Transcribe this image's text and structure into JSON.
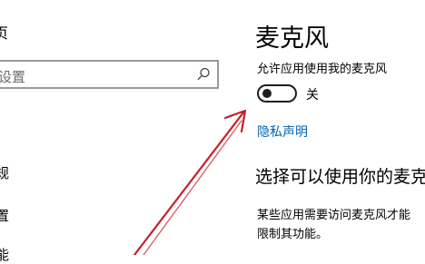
{
  "sidebar": {
    "home_label": "页",
    "search": {
      "placeholder": "设置"
    },
    "items": [
      {
        "label": "规"
      },
      {
        "label": "置"
      },
      {
        "label": "能"
      }
    ]
  },
  "main": {
    "title": "麦克风",
    "permission": {
      "label": "允许应用使用我的麦克风",
      "toggle_state": "关",
      "enabled": false
    },
    "privacy_link": "隐私声明",
    "section_title": "选择可以使用你的麦克",
    "description": {
      "line1": "某些应用需要访问麦克风才能",
      "line2": "限制其功能。"
    }
  },
  "annotation": {
    "arrow_color": "#c8202a"
  },
  "colors": {
    "link": "#0063b1",
    "toggle_off": "#1f1f1f",
    "search_border": "#999999"
  }
}
